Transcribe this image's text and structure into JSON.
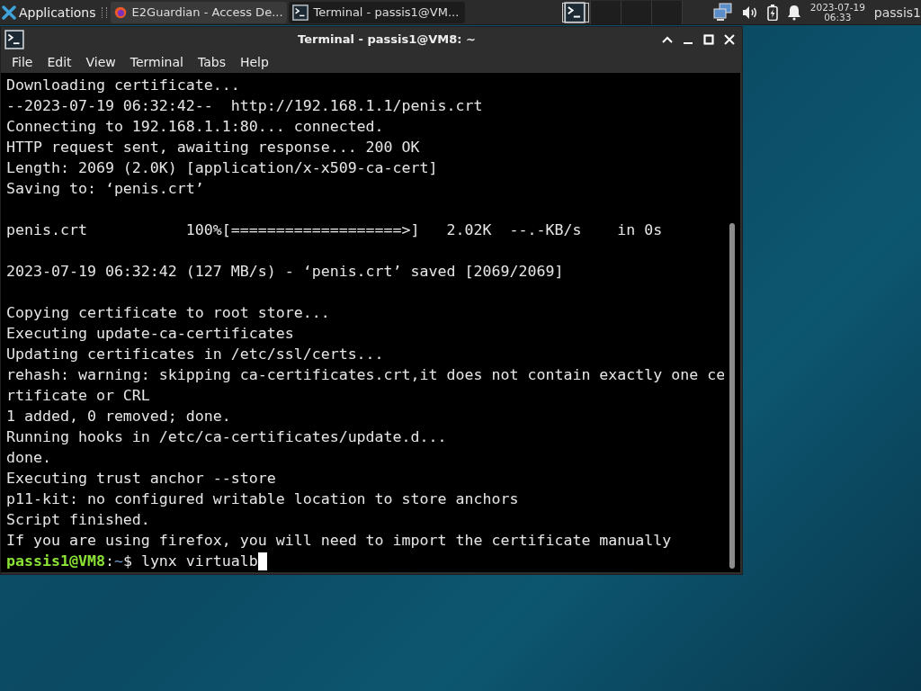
{
  "panel": {
    "applications": "Applications",
    "tasks": [
      {
        "label": "E2Guardian - Access De...",
        "kind": "browser",
        "selected": false
      },
      {
        "label": "Terminal - passis1@VM...",
        "kind": "terminal",
        "selected": true
      }
    ],
    "workspaces": [
      {
        "selected": true,
        "kind": "terminal"
      },
      {
        "selected": false
      },
      {
        "selected": false
      },
      {
        "selected": false
      }
    ],
    "clock": {
      "date": "2023-07-19",
      "time": "06:33"
    },
    "user": "passis1"
  },
  "window": {
    "title": "Terminal - passis1@VM8: ~",
    "menu": [
      "File",
      "Edit",
      "View",
      "Terminal",
      "Tabs",
      "Help"
    ],
    "lines": [
      {
        "text": "Downloading certificate..."
      },
      {
        "text": "--2023-07-19 06:32:42--  http://192.168.1.1/penis.crt"
      },
      {
        "text": "Connecting to 192.168.1.1:80... connected."
      },
      {
        "text": "HTTP request sent, awaiting response... 200 OK"
      },
      {
        "text": "Length: 2069 (2.0K) [application/x-x509-ca-cert]"
      },
      {
        "text": "Saving to: ‘penis.crt’"
      },
      {
        "kind": "blank"
      },
      {
        "text": "penis.crt           100%[===================>]   2.02K  --.-KB/s    in 0s"
      },
      {
        "kind": "blank"
      },
      {
        "text": "2023-07-19 06:32:42 (127 MB/s) - ‘penis.crt’ saved [2069/2069]"
      },
      {
        "kind": "blank"
      },
      {
        "text": "Copying certificate to root store..."
      },
      {
        "text": "Executing update-ca-certificates"
      },
      {
        "text": "Updating certificates in /etc/ssl/certs..."
      },
      {
        "text": "rehash: warning: skipping ca-certificates.crt,it does not contain exactly one ce"
      },
      {
        "text": "rtificate or CRL"
      },
      {
        "text": "1 added, 0 removed; done."
      },
      {
        "text": "Running hooks in /etc/ca-certificates/update.d..."
      },
      {
        "text": "done."
      },
      {
        "text": "Executing trust anchor --store"
      },
      {
        "text": "p11-kit: no configured writable location to store anchors"
      },
      {
        "text": "Script finished."
      },
      {
        "text": "If you are using firefox, you will need to import the certificate manually"
      },
      {
        "kind": "prompt",
        "user_host": "passis1@VM8",
        "separator": ":",
        "path": "~",
        "command": "$ lynx virtualb"
      }
    ]
  }
}
